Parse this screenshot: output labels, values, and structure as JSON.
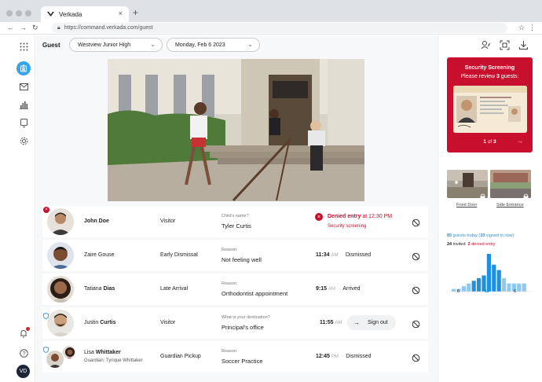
{
  "browser": {
    "tab_title": "Verkada",
    "tab_close": "×",
    "new_tab": "+",
    "url": "https://command.verkada.com/guest"
  },
  "topbar": {
    "title": "Guest",
    "site": "Westview Junior High",
    "date": "Monday, Feb 6 2023"
  },
  "user_initials": "VD",
  "rows": [
    {
      "name_plain": "",
      "name_bold": "John Doe",
      "type": "Visitor",
      "q_label": "Child's name?",
      "q_answer": "Tyler Curtis",
      "status": "denied",
      "denied_main": "Denied entry",
      "denied_time": "at 12:30 PM",
      "denied_sub": "Security screening"
    },
    {
      "name_plain": "Zaire Gouse",
      "type": "Early Dismissal",
      "q_label": "Reason:",
      "q_answer": "Not feeling well",
      "time": "11:34",
      "ampm": "AM",
      "status_text": "Dismissed"
    },
    {
      "name_plain": "Tatiana ",
      "name_bold": "Dias",
      "type": "Late Arrival",
      "q_label": "Reason:",
      "q_answer": "Orthodontist appointment",
      "time": "9:15",
      "ampm": "AM",
      "status_text": "Arrived"
    },
    {
      "name_plain": "Justin ",
      "name_bold": "Curtis",
      "type": "Visitor",
      "q_label": "What is your destination?",
      "q_answer": "Principal's office",
      "time": "11:55",
      "ampm": "AM",
      "action_label": "Sign out"
    },
    {
      "name_plain": "Lisa ",
      "name_bold": "Whittaker",
      "guardian": "Guardian: Tyrique Whittaker",
      "type": "Guardian Pickup",
      "q_label": "Reason:",
      "q_answer": "Soccer Practice",
      "time": "12:45",
      "ampm": "PM",
      "status_text": "Dismissed"
    }
  ],
  "screening": {
    "title": "Security Screening",
    "sub_pre": "Please review ",
    "sub_count": "3",
    "sub_post": " guests:",
    "page_current": "1",
    "page_of": "of",
    "page_total": "3"
  },
  "cameras": [
    {
      "label": "Front Door"
    },
    {
      "label": "Side Entrance"
    }
  ],
  "stats": {
    "guests_count": "85",
    "guests_text": " guests today (",
    "signed_in": "33",
    "signed_text": " signed in now)",
    "invited_count": "24",
    "invited_text": " invited",
    "denied_count": "2",
    "denied_text": " denied entry"
  },
  "chart_data": {
    "type": "bar",
    "values": [
      1,
      1,
      2,
      3,
      4,
      5,
      6,
      14,
      10,
      8,
      5,
      3,
      3,
      3,
      3
    ],
    "tick_labels": [
      "6",
      "12",
      "6"
    ],
    "highlight_color": "#1e90e0",
    "base_color": "#8fc8f0"
  },
  "colors": {
    "accent": "#3aa3e8",
    "danger": "#c8102e"
  }
}
